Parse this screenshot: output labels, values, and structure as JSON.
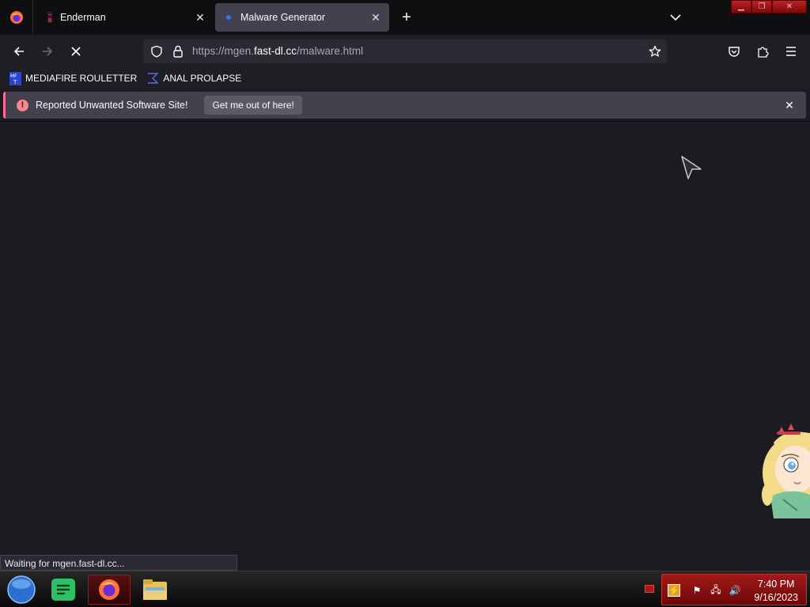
{
  "tabs": [
    {
      "title": "Enderman",
      "active": false
    },
    {
      "title": "Malware Generator",
      "active": true
    }
  ],
  "urlbar": {
    "prefix": "https://mgen.",
    "host": "fast-dl.cc",
    "path": "/malware.html"
  },
  "bookmarks": [
    {
      "label": "MEDIAFIRE ROULETTER",
      "icon": "mediafire-icon"
    },
    {
      "label": "ANAL PROLAPSE",
      "icon": "bookmark-sigma-icon"
    }
  ],
  "notification": {
    "message": "Reported Unwanted Software Site!",
    "button": "Get me out of here!"
  },
  "status_text": "Waiting for mgen.fast-dl.cc...",
  "clock": {
    "time": "7:40 PM",
    "date": "9/16/2023"
  },
  "colors": {
    "accent": "#ff6b9a",
    "tab_active": "#42414d",
    "taskbar_tray": "#a11a1a"
  }
}
